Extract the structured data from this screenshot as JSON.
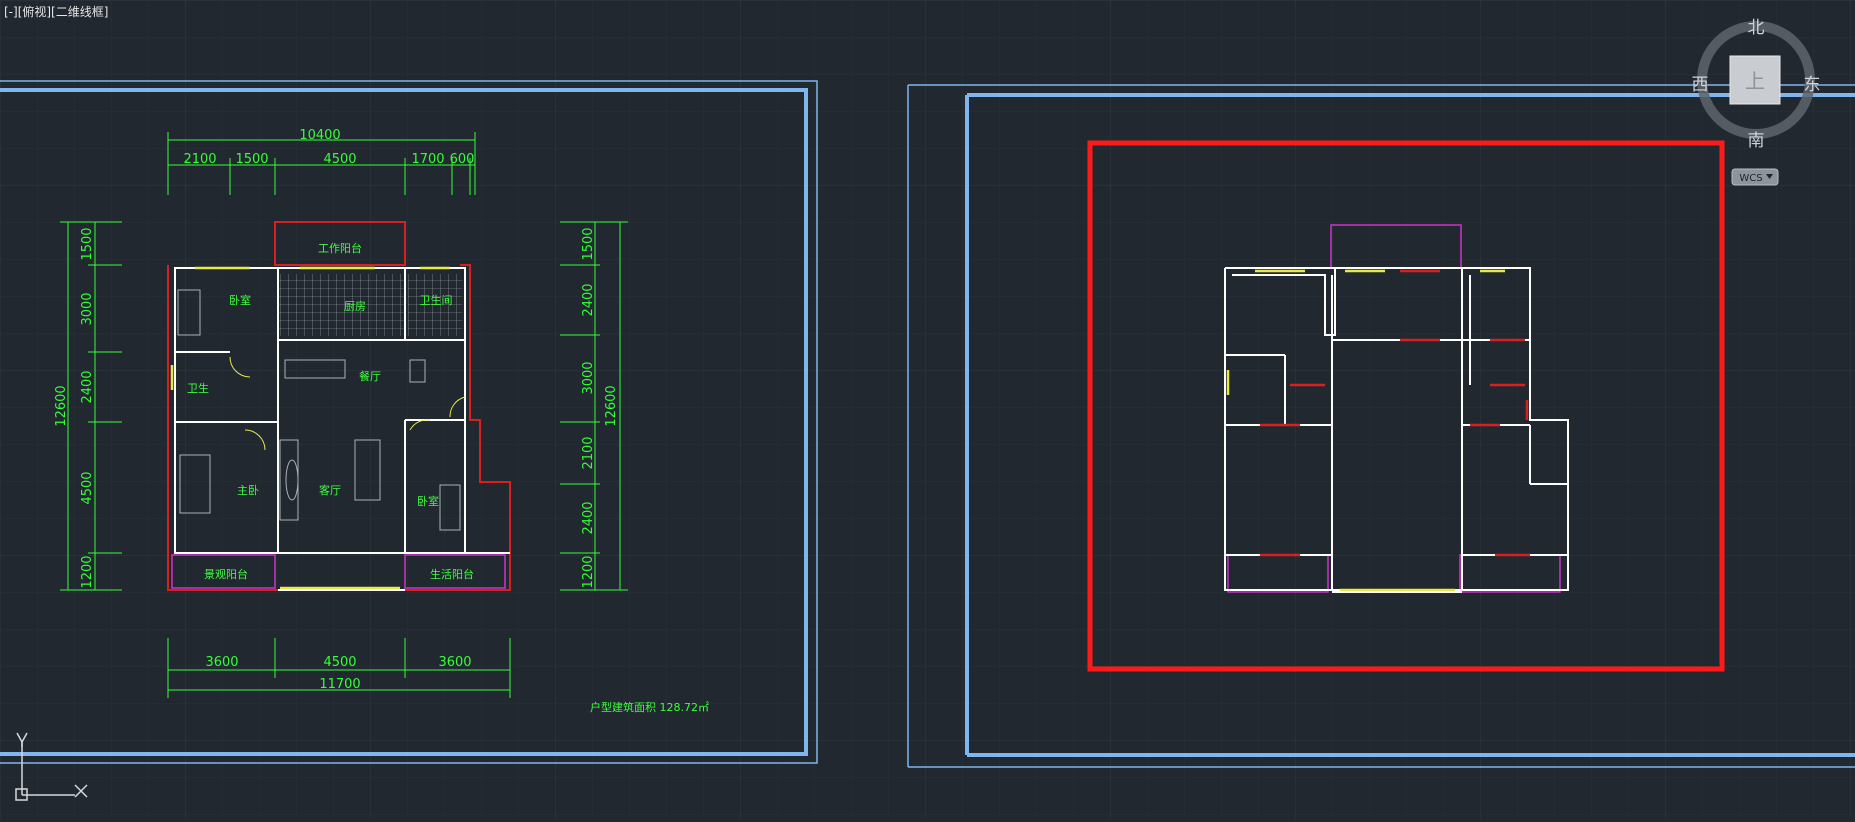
{
  "viewport": {
    "label": "[-][俯视][二维线框]"
  },
  "viewcube": {
    "north": "北",
    "south": "南",
    "east": "东",
    "west": "西",
    "face": "上",
    "ucs": "WCS"
  },
  "plan": {
    "dims_top": {
      "total": "10400",
      "segments": [
        "2100",
        "1500",
        "4500",
        "1700",
        "600"
      ]
    },
    "dims_bottom": {
      "segments": [
        "3600",
        "4500",
        "3600"
      ],
      "total": "11700"
    },
    "dims_left": {
      "total": "12600",
      "segments": [
        "1500",
        "3000",
        "2400",
        "4500",
        "1200"
      ]
    },
    "dims_right": {
      "total": "12600",
      "segments": [
        "1500",
        "2400",
        "3000",
        "2100",
        "2400",
        "1200"
      ]
    },
    "rooms": {
      "work_balcony": "工作阳台",
      "kitchen": "厨房",
      "bedroom_nw": "卧室",
      "bathroom_main": "卫生间",
      "bathroom_small": "卫生",
      "dining": "餐厅",
      "master_bedroom": "主卧",
      "living": "客厅",
      "bedroom_se": "卧室",
      "view_balcony": "景观阳台",
      "life_balcony": "生活阳台"
    },
    "area_note": "户型建筑面积 128.72㎡"
  },
  "ucs_icon": {
    "x_label": "X",
    "y_label": "Y"
  },
  "colors": {
    "background": "#212830",
    "grid": "#2b333c",
    "frame": "#7fb6ee",
    "dimension": "#35ff35",
    "walls": "#ffffff",
    "selection": "#ff1a1a",
    "balcony": "#cc33cc",
    "window": "#e8e84a"
  }
}
